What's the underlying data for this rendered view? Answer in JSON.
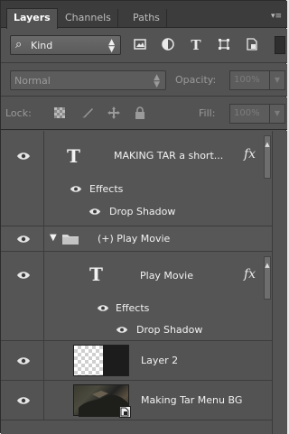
{
  "tabs": [
    {
      "label": "Layers",
      "active": true
    },
    {
      "label": "Channels",
      "active": false
    },
    {
      "label": "Paths",
      "active": false
    }
  ],
  "filter": {
    "kind_label": "Kind",
    "icons": [
      "image-filter-icon",
      "adjustment-filter-icon",
      "type-filter-icon",
      "shape-filter-icon",
      "smart-object-filter-icon"
    ]
  },
  "blend": {
    "mode": "Normal",
    "opacity_label": "Opacity:",
    "opacity_value": "100%"
  },
  "lock": {
    "label": "Lock:",
    "fill_label": "Fill:",
    "fill_value": "100%"
  },
  "layers": [
    {
      "type": "text",
      "name": "MAKING TAR a short...",
      "fx": "fx",
      "effects_label": "Effects",
      "effect_name": "Drop Shadow"
    },
    {
      "type": "group",
      "name": "(+) Play Movie"
    },
    {
      "type": "text",
      "name": "Play Movie",
      "fx": "fx",
      "effects_label": "Effects",
      "effect_name": "Drop Shadow"
    },
    {
      "type": "raster",
      "name": "Layer 2"
    },
    {
      "type": "smart",
      "name": "Making Tar Menu BG"
    }
  ],
  "colors": {
    "panel_bg": "#535353",
    "tab_bar_bg": "#3c3c3c",
    "text": "#f2f2f2",
    "muted": "#9a9a9a"
  }
}
